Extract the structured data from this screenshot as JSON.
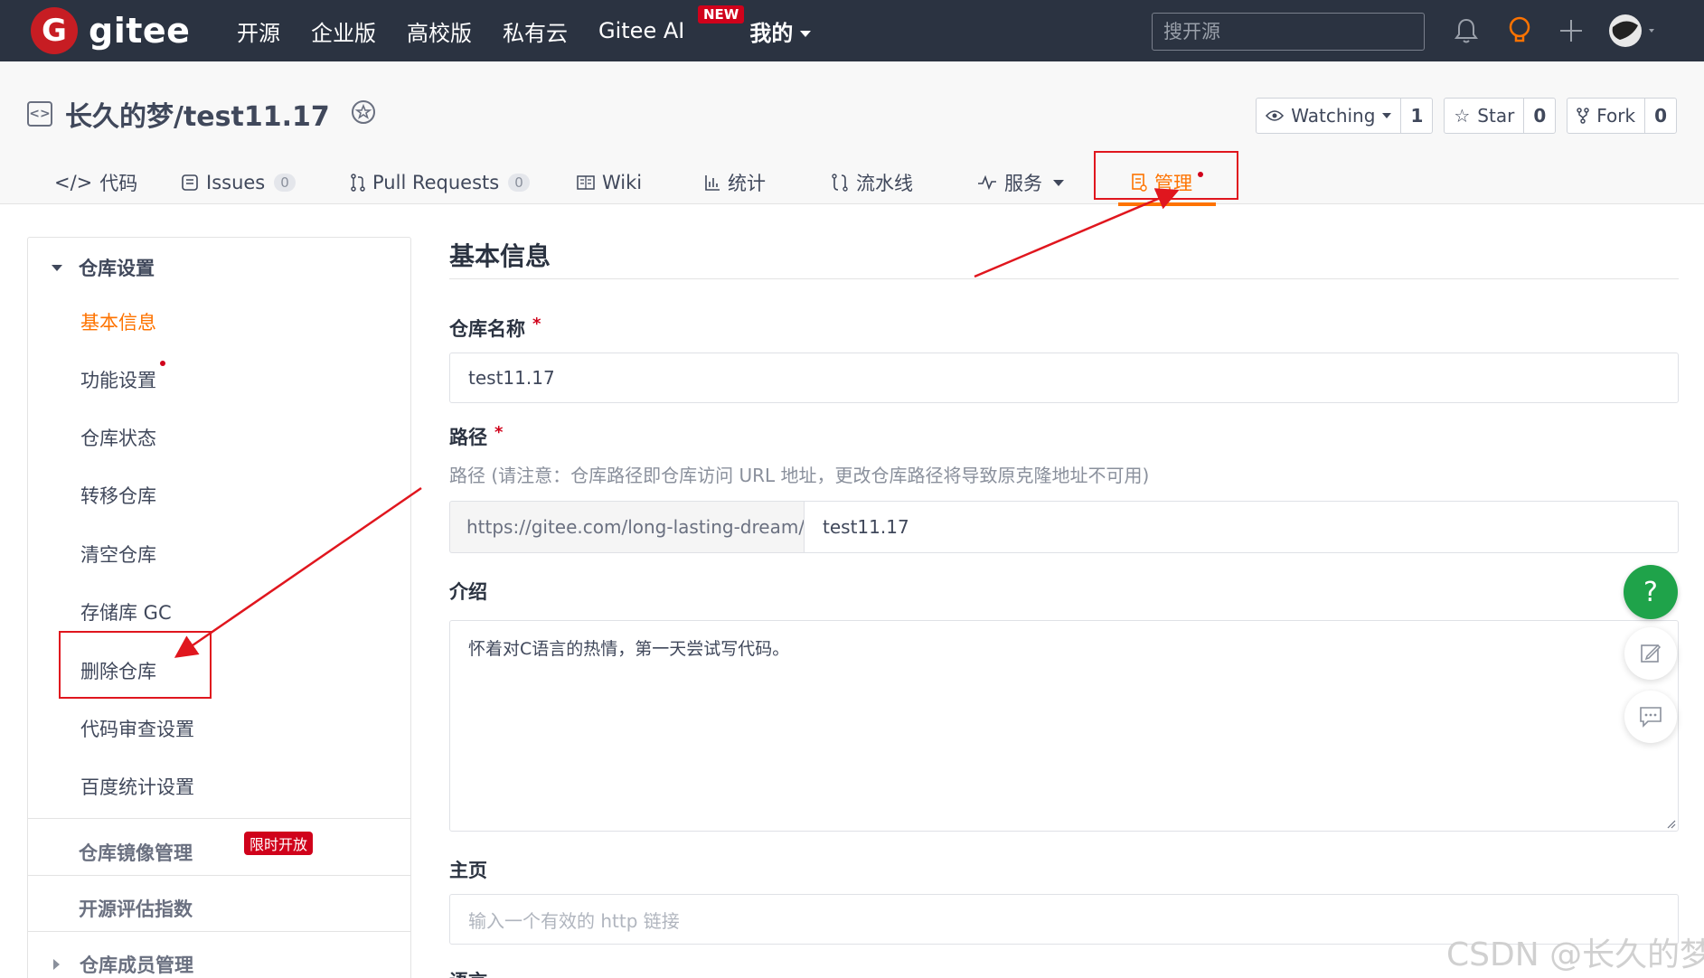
{
  "topbar": {
    "logo_letter": "G",
    "logo_text": "gitee",
    "nav": [
      {
        "label": "开源"
      },
      {
        "label": "企业版"
      },
      {
        "label": "高校版"
      },
      {
        "label": "私有云"
      },
      {
        "label": "Gitee AI",
        "badge": "NEW"
      },
      {
        "label": "我的"
      }
    ],
    "search_placeholder": "搜开源",
    "icons": [
      "bell-icon",
      "lightbulb-icon",
      "plus-icon",
      "avatar"
    ]
  },
  "repo": {
    "title": "长久的梦/test11.17",
    "watching_label": "Watching",
    "watching_count": "1",
    "star_label": "Star",
    "star_count": "0",
    "fork_label": "Fork",
    "fork_count": "0",
    "tabs": [
      {
        "label": "代码",
        "icon": "code-icon"
      },
      {
        "label": "Issues",
        "count": "0",
        "icon": "issues-icon"
      },
      {
        "label": "Pull Requests",
        "count": "0",
        "icon": "pull-request-icon"
      },
      {
        "label": "Wiki",
        "icon": "wiki-icon"
      },
      {
        "label": "统计",
        "icon": "chart-icon"
      },
      {
        "label": "流水线",
        "icon": "pipeline-icon"
      },
      {
        "label": "服务",
        "icon": "pulse-icon"
      },
      {
        "label": "管理",
        "icon": "manage-icon",
        "active": true
      }
    ]
  },
  "sidebar": {
    "section_title": "仓库设置",
    "items": [
      {
        "label": "基本信息",
        "active": true
      },
      {
        "label": "功能设置"
      },
      {
        "label": "仓库状态"
      },
      {
        "label": "转移仓库"
      },
      {
        "label": "清空仓库"
      },
      {
        "label": "存储库 GC"
      },
      {
        "label": "删除仓库"
      },
      {
        "label": "代码审查设置"
      },
      {
        "label": "百度统计设置"
      }
    ],
    "group_mirror": "仓库镜像管理",
    "group_mirror_badge": "限时开放",
    "group_eval": "开源评估指数",
    "group_members": "仓库成员管理"
  },
  "form": {
    "title": "基本信息",
    "name_label": "仓库名称",
    "required_mark": "*",
    "name_value": "test11.17",
    "path_label": "路径",
    "path_hint": "路径 (请注意：仓库路径即仓库访问 URL 地址，更改仓库路径将导致原克隆地址不可用)",
    "path_prefix": "https://gitee.com/long-lasting-dream/",
    "path_value": "test11.17",
    "intro_label": "介绍",
    "intro_value": "怀着对C语言的热情，第一天尝试写代码。",
    "homepage_label": "主页",
    "homepage_placeholder": "输入一个有效的 http 链接",
    "lang_label": "语言"
  },
  "floating": {
    "help_label": "?"
  },
  "watermark": "CSDN @长久的梦",
  "colors": {
    "topbar_bg": "#2b3341",
    "accent": "#fe7300",
    "brand_red": "#c71d23",
    "annotation_red": "#e0161e",
    "help_green": "#1fa34a"
  }
}
